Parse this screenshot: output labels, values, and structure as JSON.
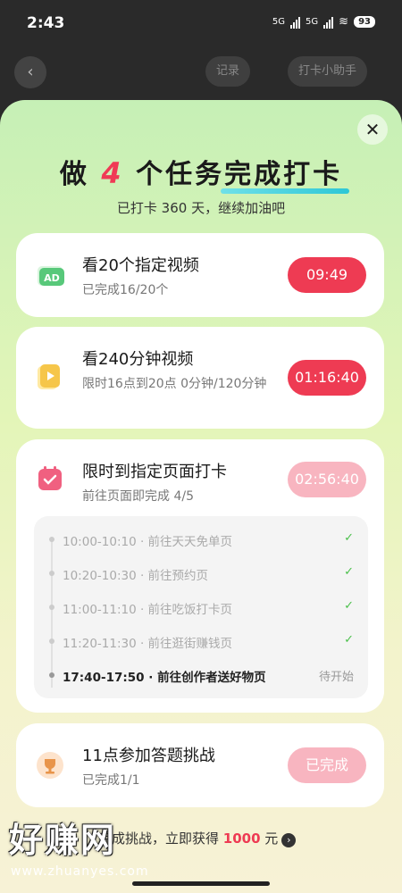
{
  "status_bar": {
    "time": "2:43",
    "net1": "5G",
    "net2": "5G",
    "battery": "93"
  },
  "background_nav": {
    "pill_record": "记录",
    "pill_helper": "打卡小助手"
  },
  "header": {
    "title_prefix": "做",
    "title_count": "4",
    "title_middle": "个任务",
    "title_highlight": "完成打卡",
    "subtitle": "已打卡 360 天，继续加油吧"
  },
  "tasks": [
    {
      "title": "看20个指定视频",
      "subtitle": "已完成16/20个",
      "timer": "09:49",
      "icon": "ad-icon"
    },
    {
      "title": "看240分钟视频",
      "subtitle": "限时16点到20点 0分钟/120分钟",
      "timer": "01:16:40",
      "icon": "video-icon"
    },
    {
      "title": "限时到指定页面打卡",
      "subtitle": "前往页面即完成 4/5",
      "timer": "02:56:40",
      "icon": "calendar-check-icon",
      "items": [
        {
          "text": "10:00-10:10 · 前往天天免单页",
          "status": "✓"
        },
        {
          "text": "10:20-10:30 · 前往预约页",
          "status": "✓"
        },
        {
          "text": "11:00-11:10 · 前往吃饭打卡页",
          "status": "✓"
        },
        {
          "text": "11:20-11:30 · 前往逛街赚钱页",
          "status": "✓"
        },
        {
          "text": "17:40-17:50 · 前往创作者送好物页",
          "status": "待开始"
        }
      ]
    },
    {
      "title": "11点参加答题挑战",
      "subtitle": "已完成1/1",
      "button": "已完成",
      "icon": "trophy-icon"
    }
  ],
  "footer": {
    "prefix": "完成挑战，立即获得 ",
    "amount": "1000",
    "suffix": " 元"
  },
  "watermark": {
    "brand": "好赚网",
    "url": "www.zhuanyes.com"
  },
  "colors": {
    "accent": "#ee3b53",
    "check": "#4cc04c",
    "sheet_top": "#c6f0b6"
  }
}
